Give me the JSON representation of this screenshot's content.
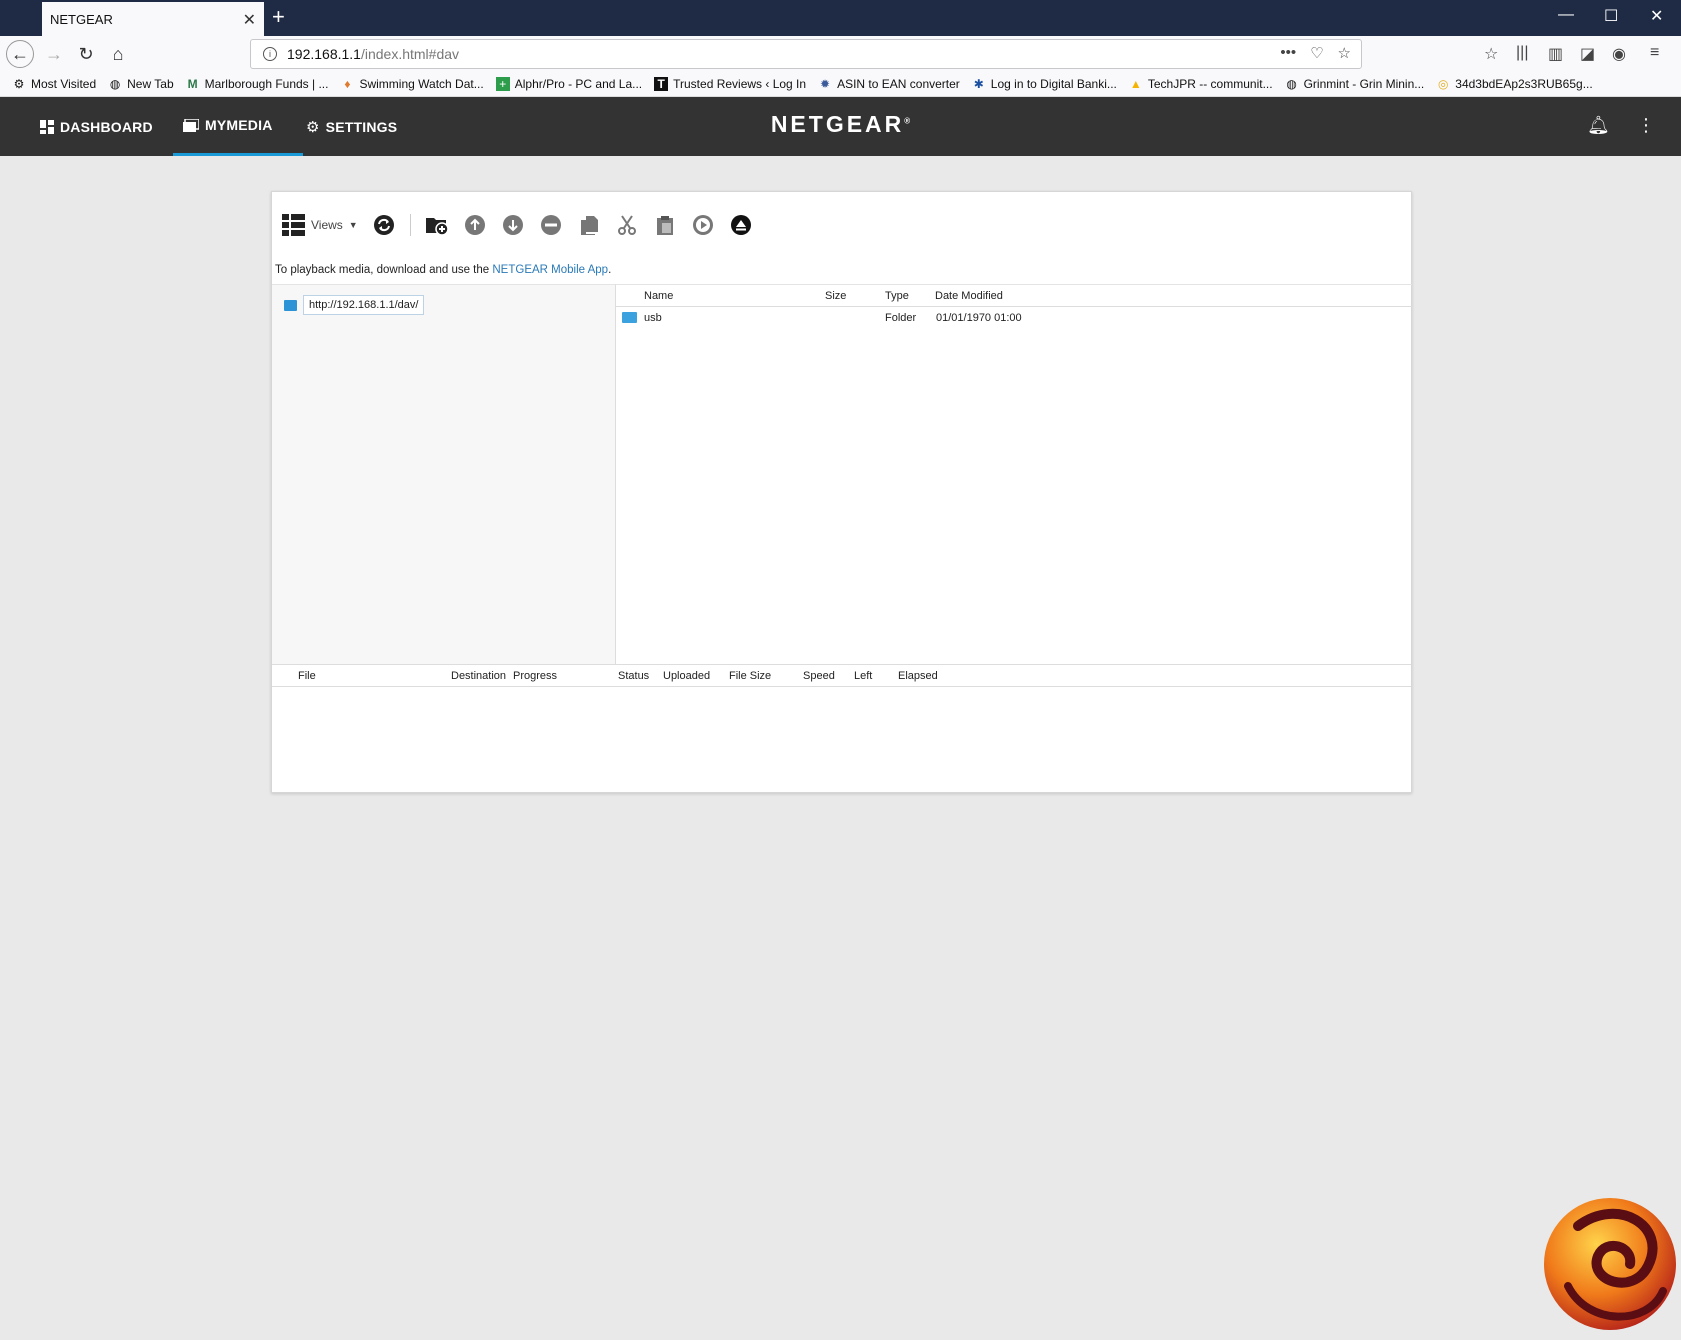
{
  "browser": {
    "tab_title": "NETGEAR",
    "url_host": "192.168.1.1",
    "url_path": "/index.html#dav",
    "bookmarks": [
      "Most Visited",
      "New Tab",
      "Marlborough Funds | ...",
      "Swimming Watch Dat...",
      "Alphr/Pro - PC and La...",
      "Trusted Reviews ‹ Log In",
      "ASIN to EAN converter",
      "Log in to Digital Banki...",
      "TechJPR -- communit...",
      "Grinmint - Grin Minin...",
      "34d3bdEAp2s3RUB65g..."
    ]
  },
  "app": {
    "brand": "NETGEAR",
    "nav": {
      "dashboard": "DASHBOARD",
      "mymedia": "MYMEDIA",
      "settings": "SETTINGS"
    },
    "active_tab": "MYMEDIA",
    "accent_color": "#1a9ad6",
    "header_color": "#333333"
  },
  "toolbar": {
    "views_label": "Views",
    "icons": [
      "refresh-icon",
      "new-folder-icon",
      "upload-icon",
      "download-icon",
      "delete-icon",
      "copy-icon",
      "cut-icon",
      "paste-icon",
      "play-icon",
      "eject-icon"
    ]
  },
  "info": {
    "prefix": "To playback media, download and use the",
    "link": "NETGEAR Mobile App",
    "suffix": "."
  },
  "tree": {
    "root_label": "http://192.168.1.1/dav/"
  },
  "files": {
    "columns": {
      "name": "Name",
      "size": "Size",
      "type": "Type",
      "date": "Date Modified"
    },
    "rows": [
      {
        "name": "usb",
        "size": "",
        "type": "Folder",
        "date": "01/01/1970 01:00"
      }
    ]
  },
  "queue": {
    "columns": {
      "file": "File",
      "destination": "Destination",
      "progress": "Progress",
      "status": "Status",
      "uploaded": "Uploaded",
      "file_size": "File Size",
      "speed": "Speed",
      "left": "Left",
      "elapsed": "Elapsed"
    }
  }
}
